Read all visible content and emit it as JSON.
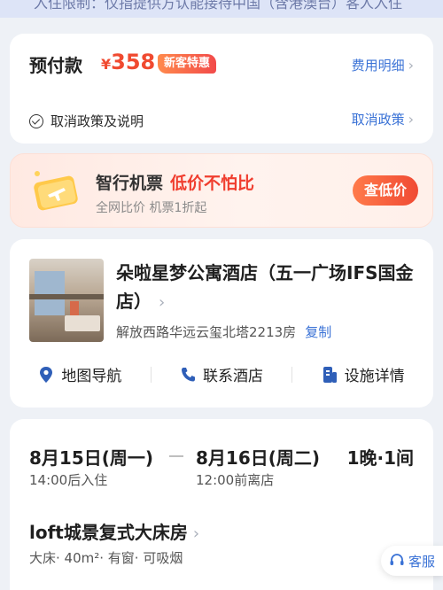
{
  "notice": {
    "text": "入住限制：仅指提供方认能接待中国（含港澳台）客人入住"
  },
  "payment": {
    "label": "预付款",
    "currency": "¥",
    "amount": "358",
    "badge": "新客特惠",
    "fee_detail_link": "费用明细",
    "policy_label": "取消政策及说明",
    "policy_link": "取消政策"
  },
  "banner": {
    "title": "智行机票",
    "highlight": "低价不怕比",
    "subtitle": "全网比价 机票1折起",
    "cta": "查低价"
  },
  "hotel": {
    "name": "朵啦星梦公寓酒店（五一广场IFS国金店）",
    "address": "解放西路华远云玺北塔2213房",
    "copy_label": "复制",
    "actions": {
      "map": "地图导航",
      "contact": "联系酒店",
      "facilities": "设施详情"
    }
  },
  "stay": {
    "checkin_date": "8月15日(周一)",
    "checkout_date": "8月16日(周二)",
    "nights": "1晚·1间",
    "checkin_time": "14:00后入住",
    "checkout_time": "12:00前离店",
    "room_name": "loft城景复式大床房",
    "room_features": "大床· 40m²· 有窗· 可吸烟"
  },
  "service": {
    "label": "客服"
  },
  "colors": {
    "accent": "#3a72d6",
    "price": "#f04a30"
  }
}
